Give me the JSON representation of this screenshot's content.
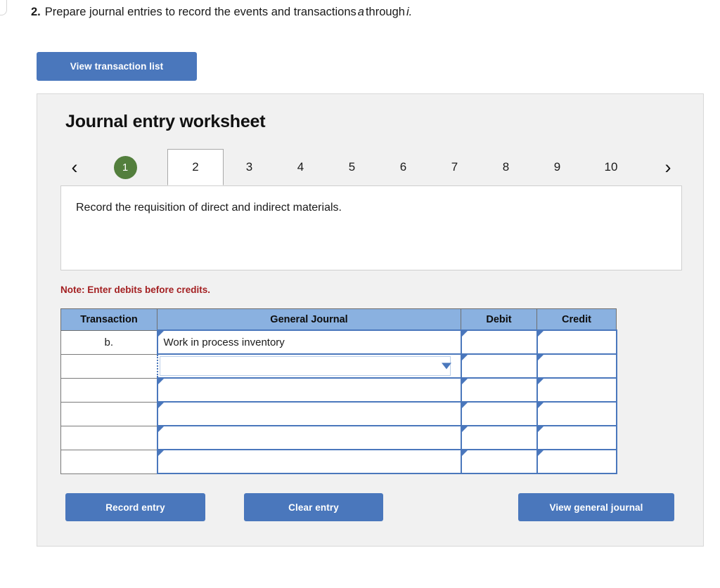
{
  "question": {
    "number": "2.",
    "text_before": "Prepare journal entries to record the events and transactions",
    "italic_1": "a",
    "text_middle": "through",
    "italic_2": "i."
  },
  "toolbar": {
    "view_transaction_list": "View transaction list"
  },
  "panel": {
    "title": "Journal entry worksheet"
  },
  "tabs": {
    "prev_icon": "chevron-left",
    "next_icon": "chevron-right",
    "items": [
      {
        "label": "1",
        "state": "completed"
      },
      {
        "label": "2",
        "state": "active"
      },
      {
        "label": "3",
        "state": "default"
      },
      {
        "label": "4",
        "state": "default"
      },
      {
        "label": "5",
        "state": "default"
      },
      {
        "label": "6",
        "state": "default"
      },
      {
        "label": "7",
        "state": "default"
      },
      {
        "label": "8",
        "state": "default"
      },
      {
        "label": "9",
        "state": "default"
      },
      {
        "label": "10",
        "state": "default"
      }
    ]
  },
  "prompt": {
    "text": "Record the requisition of direct and indirect materials."
  },
  "note": {
    "text": "Note: Enter debits before credits."
  },
  "journal": {
    "columns": [
      "Transaction",
      "General Journal",
      "Debit",
      "Credit"
    ],
    "rows": [
      {
        "transaction": "b.",
        "general_journal": "Work in process inventory",
        "debit": "",
        "credit": "",
        "selected": false
      },
      {
        "transaction": "",
        "general_journal": "",
        "debit": "",
        "credit": "",
        "selected": true
      },
      {
        "transaction": "",
        "general_journal": "",
        "debit": "",
        "credit": "",
        "selected": false
      },
      {
        "transaction": "",
        "general_journal": "",
        "debit": "",
        "credit": "",
        "selected": false
      },
      {
        "transaction": "",
        "general_journal": "",
        "debit": "",
        "credit": "",
        "selected": false
      },
      {
        "transaction": "",
        "general_journal": "",
        "debit": "",
        "credit": "",
        "selected": false
      }
    ]
  },
  "footer": {
    "record_entry": "Record entry",
    "clear_entry": "Clear entry",
    "view_general_journal": "View general journal"
  },
  "colors": {
    "button_blue": "#4a77bc",
    "table_header_blue": "#8ab1e0",
    "completed_tab_green": "#537f3d",
    "note_red": "#a31f21",
    "panel_gray": "#f1f1f1"
  }
}
